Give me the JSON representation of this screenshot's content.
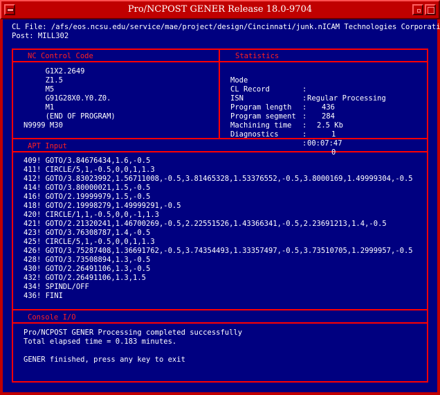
{
  "window": {
    "title": "Pro/NCPOST GENER Release 18.0-9704"
  },
  "header": {
    "cl_file_line": "CL File: /afs/eos.ncsu.edu/service/mae/project/design/Cincinnati/junk.nICAM Technologies Corporation",
    "post_line": "Post: MILL302"
  },
  "nc_panel": {
    "title": "NC Control Code",
    "lines": [
      "     G1X2.2649",
      "     Z1.5",
      "     M5",
      "     G91G28X0.Y0.Z0.",
      "     M1",
      "     (END OF PROGRAM)",
      "N9999 M30"
    ]
  },
  "stats_panel": {
    "title": "Statistics",
    "rows": [
      {
        "label": "Mode",
        "value": "Regular Processing"
      },
      {
        "label": "CL Record",
        "value": "436"
      },
      {
        "label": "ISN",
        "value": "284"
      },
      {
        "label": "Program length",
        "value": "2.5 Kb"
      },
      {
        "label": "Program segment",
        "value": "1"
      },
      {
        "label": "Machining time",
        "value": "00:07:47"
      },
      {
        "label": "Diagnostics",
        "value": "0"
      }
    ]
  },
  "apt_panel": {
    "title": "APT Input",
    "lines": [
      "409! GOTO/3.84676434,1.6,-0.5",
      "411! CIRCLE/5,1,-0.5,0,0,1,1.3",
      "412! GOTO/3.83023992,1.56711008,-0.5,3.81465328,1.53376552,-0.5,3.8000169,1.49999304,-0.5",
      "414! GOTO/3.80000021,1.5,-0.5",
      "416! GOTO/2.19999979,1.5,-0.5",
      "418! GOTO/2.19998279,1.49999291,-0.5",
      "420! CIRCLE/1,1,-0.5,0,0,-1,1.3",
      "421! GOTO/2.21320241,1.46700269,-0.5,2.22551526,1.43366341,-0.5,2.23691213,1.4,-0.5",
      "423! GOTO/3.76308787,1.4,-0.5",
      "425! CIRCLE/5,1,-0.5,0,0,1,1.3",
      "426! GOTO/3.75287408,1.36691762,-0.5,3.74354493,1.33357497,-0.5,3.73510705,1.2999957,-0.5",
      "428! GOTO/3.73508894,1.3,-0.5",
      "430! GOTO/2.26491106,1.3,-0.5",
      "432! GOTO/2.26491106,1.3,1.5",
      "434! SPINDL/OFF",
      "436! FINI"
    ]
  },
  "console_panel": {
    "title": "Console I/O",
    "lines": [
      "Pro/NCPOST GENER Processing completed successfully",
      "Total elapsed time = 0.183 minutes.",
      "",
      "GENER finished, press any key to exit"
    ]
  },
  "colors": {
    "background": "#000080",
    "frame": "#c00000",
    "panel_border": "#ff0000",
    "panel_title": "#ff2020",
    "text": "#ffffff"
  }
}
